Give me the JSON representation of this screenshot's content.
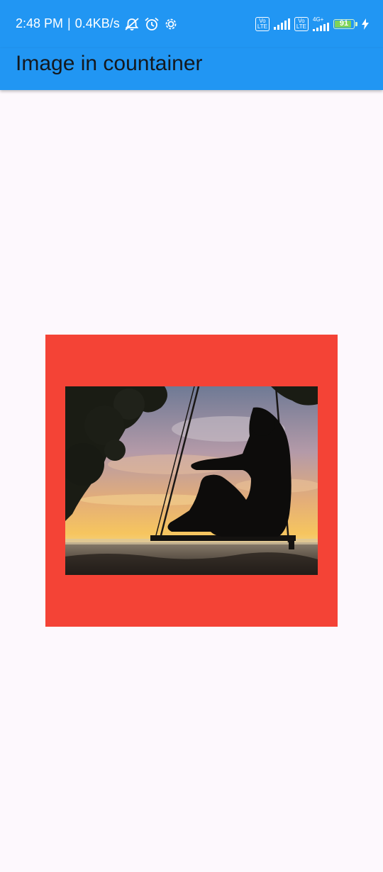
{
  "status_bar": {
    "time": "2:48 PM",
    "separator": "|",
    "net_speed": "0.4KB/s",
    "icons": [
      "mute-notifications-icon",
      "alarm-icon",
      "settings-gear-icon",
      "volte-icon",
      "signal-icon",
      "volte-icon",
      "4g-plus-signal-icon",
      "battery-icon",
      "charging-icon"
    ],
    "volte_label": "Vo\nLTE",
    "network_label": "4G+",
    "battery_level": "91",
    "battery_fraction": 0.91
  },
  "app_bar": {
    "title": "Image in countainer",
    "color": "#2196f3"
  },
  "main": {
    "container_color": "#f44336",
    "image_description_icon": "photo-image"
  }
}
